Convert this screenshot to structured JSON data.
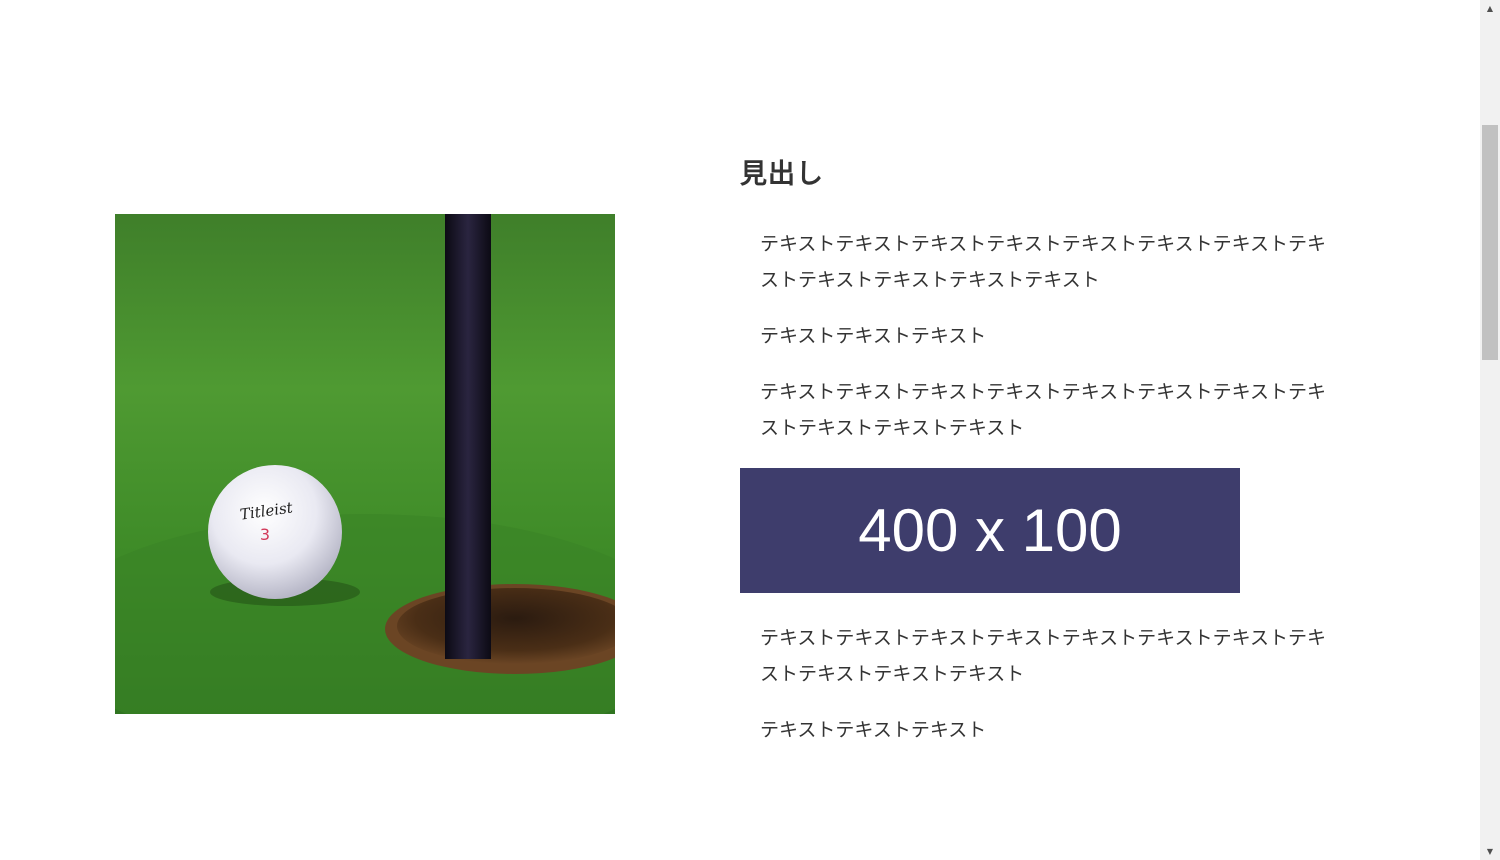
{
  "section": {
    "heading": "見出し",
    "paragraphs": [
      "テキストテキストテキストテキストテキストテキストテキストテキストテキストテキストテキストテキスト",
      "テキストテキストテキスト",
      "テキストテキストテキストテキストテキストテキストテキストテキストテキストテキストテキスト"
    ],
    "banner": {
      "label": "400 x 100",
      "color": "#3e3d6c"
    },
    "paragraphs_after": [
      "テキストテキストテキストテキストテキストテキストテキストテキストテキストテキストテキスト",
      "テキストテキストテキスト"
    ]
  },
  "photo": {
    "subject": "golf-ball-near-hole-icon",
    "ball_brand": "Titleist",
    "ball_number": "3"
  },
  "scrollbar": {
    "up_icon": "triangle-up-icon",
    "down_icon": "triangle-down-icon"
  }
}
